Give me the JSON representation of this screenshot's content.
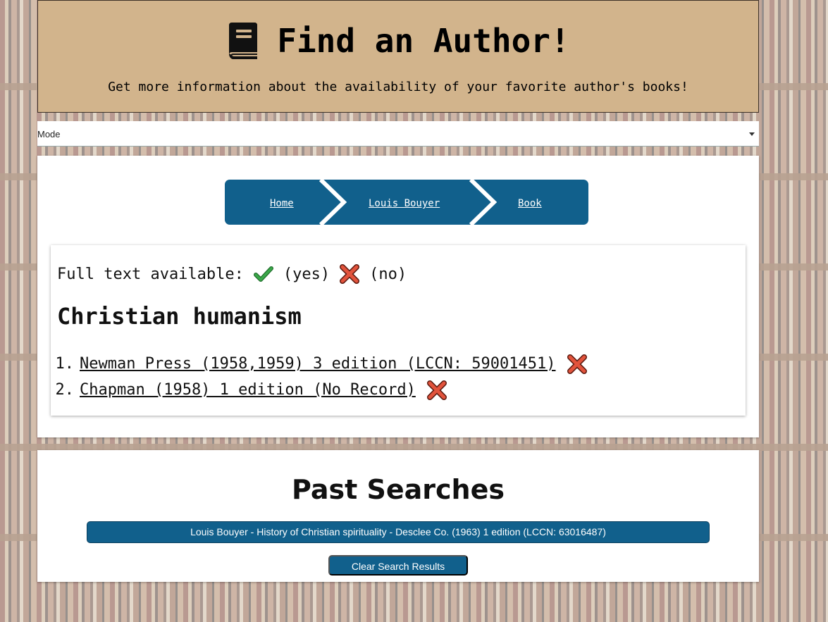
{
  "header": {
    "title": "Find an Author!",
    "subtitle": "Get more information about the availability of your favorite author's books!"
  },
  "mode_select": {
    "value": "Mode"
  },
  "breadcrumb": {
    "items": [
      {
        "label": "Home"
      },
      {
        "label": "Louis Bouyer"
      },
      {
        "label": "Book"
      }
    ]
  },
  "results": {
    "legend": {
      "label": "Full text available:",
      "yes_label": "(yes)",
      "no_label": "(no)"
    },
    "book_title": "Christian humanism",
    "editions": [
      {
        "number": "1.",
        "text": "Newman Press (1958,1959) 3 edition (LCCN: 59001451)",
        "full_text": false
      },
      {
        "number": "2.",
        "text": "Chapman (1958) 1 edition (No Record)",
        "full_text": false
      }
    ]
  },
  "past_searches": {
    "title": "Past Searches",
    "items": [
      {
        "text": "Louis Bouyer - History of Christian spirituality - Desclee Co. (1963) 1 edition (LCCN: 63016487)"
      }
    ],
    "clear_label": "Clear Search Results"
  },
  "colors": {
    "header_bg": "#d2b48c",
    "accent": "#11608c",
    "check_green": "#3aa84a",
    "cross_red": "#e2533c"
  },
  "icons": {
    "header": "book-icon",
    "yes": "check-icon",
    "no": "cross-icon"
  }
}
